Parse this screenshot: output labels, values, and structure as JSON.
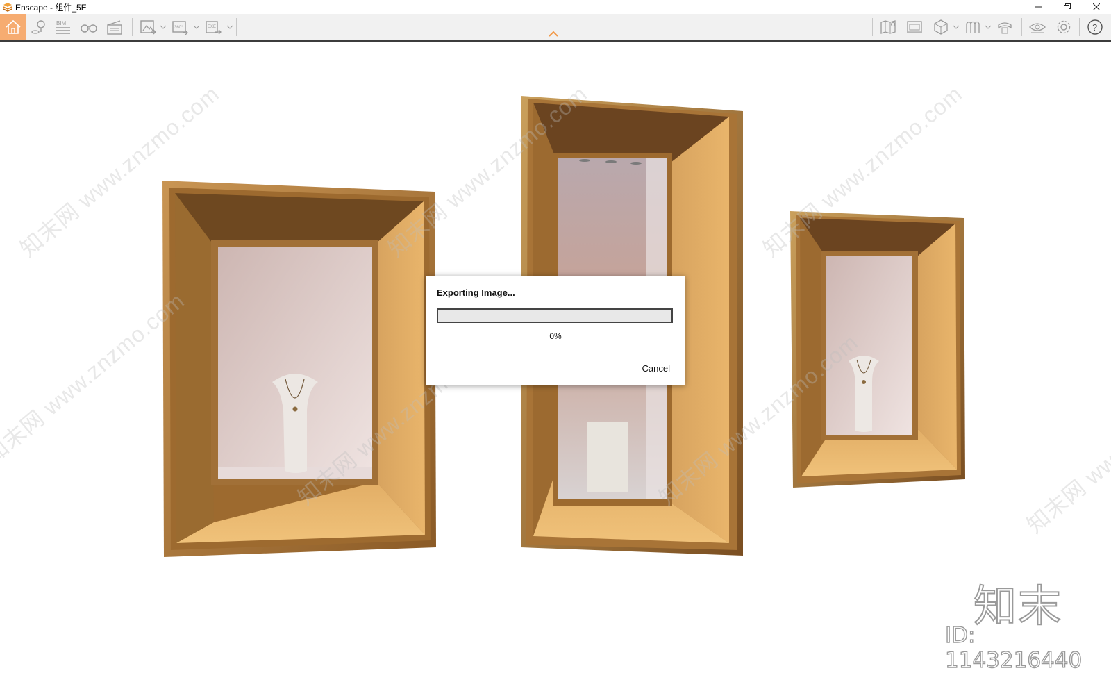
{
  "window": {
    "title": "Enscape - 组件_5E",
    "controls": [
      "minimize-icon",
      "restore-icon",
      "close-icon"
    ]
  },
  "toolbar": {
    "left_icons": [
      "home-icon",
      "location-pin-icon",
      "bim-icon",
      "binoculars-icon",
      "clapperboard-icon",
      "render-image-icon",
      "panorama-360-icon",
      "export-exe-icon"
    ],
    "right_icons": [
      "map-icon",
      "screenshot-icon",
      "cube-view-icon",
      "asset-library-icon",
      "material-icon",
      "eye-icon",
      "settings-gear-icon",
      "help-icon"
    ],
    "bim_label": "BIM",
    "pano_label": "360°",
    "exe_label": "EXE",
    "active_color": "#f6ac71",
    "collapse_icon": "chevron-up-icon"
  },
  "dialog": {
    "title": "Exporting Image...",
    "progress_percent": 0,
    "progress_label": "0%",
    "cancel_label": "Cancel"
  },
  "watermarks": {
    "site_text": "知末网 www.znzmo.com",
    "logo_text": "知末",
    "id_text": "ID: 1143216440"
  },
  "colors": {
    "gold_light": "#e2ad63",
    "gold_dark": "#6e4820",
    "accent": "#f6ac71"
  }
}
